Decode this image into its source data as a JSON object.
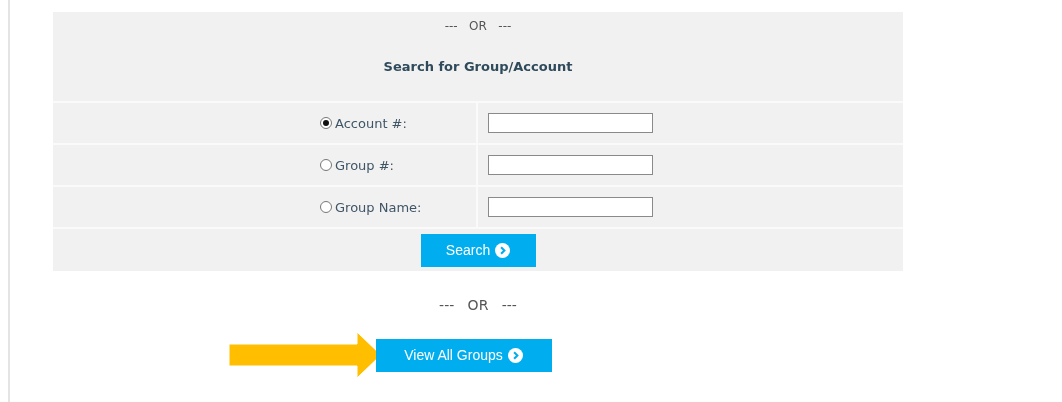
{
  "top_separator": "---   OR   ---",
  "title": "Search for Group/Account",
  "options": [
    {
      "label": "Account #:",
      "selected": true
    },
    {
      "label": "Group #:",
      "selected": false
    },
    {
      "label": "Group Name:",
      "selected": false
    }
  ],
  "search_button": "Search",
  "bottom_separator": "---   OR   ---",
  "view_all_button": "View All Groups"
}
